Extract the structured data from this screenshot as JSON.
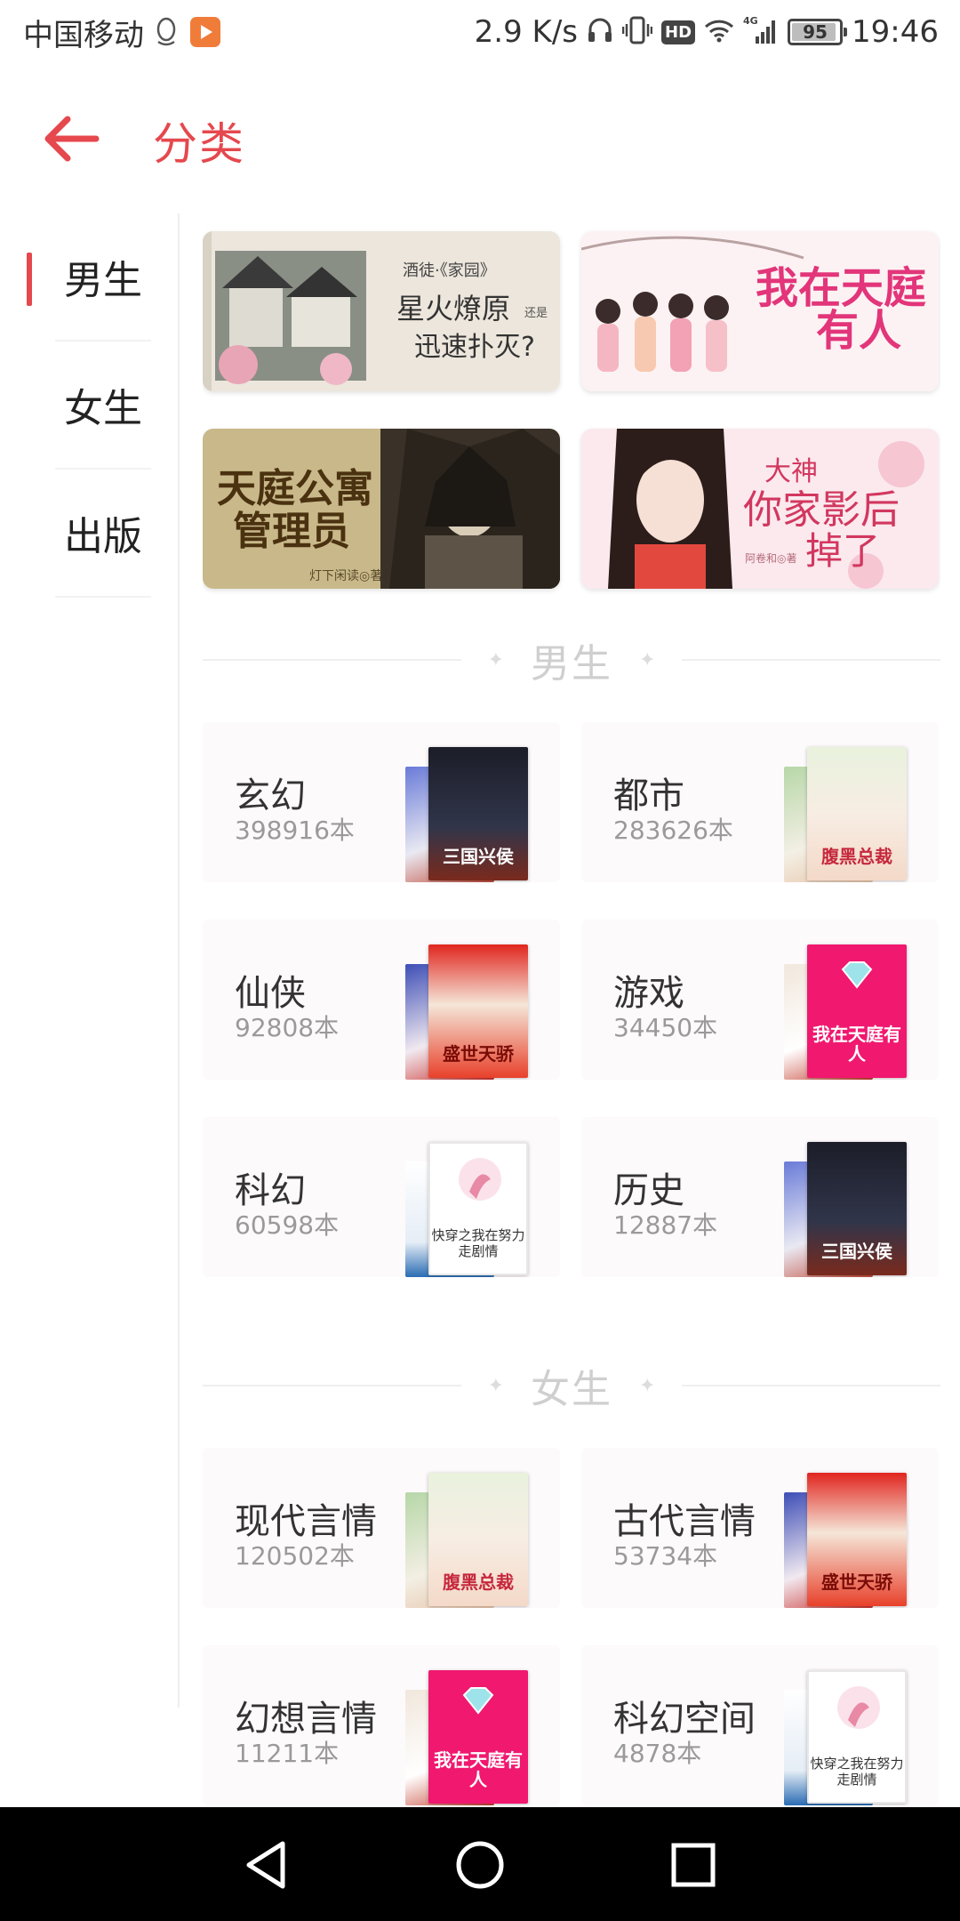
{
  "status_bar": {
    "carrier": "中国移动",
    "speed": "2.9 K/s",
    "network": "4G",
    "battery": "95",
    "battery_level": 0.95,
    "time": "19:46",
    "icons": [
      "qq-icon",
      "app-icon",
      "headset-icon",
      "vibrate-icon",
      "hd-icon",
      "wifi-icon",
      "signal-icon",
      "battery-icon"
    ]
  },
  "header": {
    "back_icon": "back-arrow-icon",
    "title": "分类",
    "accent_color": "#e5484d"
  },
  "sidebar": {
    "items": [
      {
        "label": "男生",
        "active": true
      },
      {
        "label": "女生",
        "active": false
      },
      {
        "label": "出版",
        "active": false
      }
    ]
  },
  "banners": [
    {
      "lines": [
        "酒徒·《家园》",
        "星火燎原",
        "还是",
        "迅速扑灭?"
      ]
    },
    {
      "lines": [
        "我在天庭",
        "有人"
      ]
    },
    {
      "lines": [
        "天庭公寓",
        "管理员",
        "灯下闲读◎著"
      ]
    },
    {
      "lines": [
        "大神",
        "你家影后",
        "掉了",
        "阿卷和◎著"
      ]
    }
  ],
  "sections": [
    {
      "title": "男生",
      "categories": [
        {
          "name": "玄幻",
          "count": "398916本",
          "cover_text": "三国兴侯"
        },
        {
          "name": "都市",
          "count": "283626本",
          "cover_text": "腹黑总裁"
        },
        {
          "name": "仙侠",
          "count": "92808本",
          "cover_text": "盛世天骄"
        },
        {
          "name": "游戏",
          "count": "34450本",
          "cover_text": "我在天庭有人"
        },
        {
          "name": "科幻",
          "count": "60598本",
          "cover_text": "快穿之我在努力走剧情"
        },
        {
          "name": "历史",
          "count": "12887本",
          "cover_text": "三国兴侯"
        }
      ]
    },
    {
      "title": "女生",
      "categories": [
        {
          "name": "现代言情",
          "count": "120502本",
          "cover_text": "腹黑总裁"
        },
        {
          "name": "古代言情",
          "count": "53734本",
          "cover_text": "盛世天骄"
        },
        {
          "name": "幻想言情",
          "count": "11211本",
          "cover_text": "我在天庭有人"
        },
        {
          "name": "科幻空间",
          "count": "4878本",
          "cover_text": "快穿之我在努力走剧情"
        }
      ]
    }
  ],
  "nav_bar": {
    "icons": [
      "back-triangle-icon",
      "home-circle-icon",
      "recents-square-icon"
    ]
  }
}
